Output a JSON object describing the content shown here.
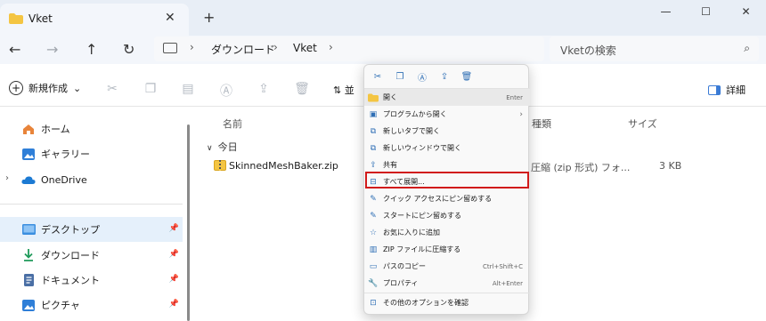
{
  "window": {
    "tab_title": "Vket",
    "tab_close": "✕",
    "new_tab": "+",
    "controls": [
      "—",
      "☐",
      "✕"
    ]
  },
  "nav": {
    "back": "←",
    "forward": "→",
    "up": "↑",
    "refresh": "↻"
  },
  "address": {
    "crumbs": [
      "ダウンロード",
      "Vket"
    ],
    "separator": "›"
  },
  "search": {
    "placeholder": "Vketの検索",
    "icon": "⌕"
  },
  "commandbar": {
    "new_label": "新規作成",
    "new_caret": "⌄",
    "sort_label": "並",
    "detail_label": "詳細"
  },
  "sidebar": {
    "items": [
      {
        "label": "ホーム",
        "icon": "home-icon"
      },
      {
        "label": "ギャラリー",
        "icon": "gallery-icon"
      },
      {
        "label": "OneDrive",
        "icon": "cloud-icon"
      },
      {
        "label": "デスクトップ",
        "icon": "desktop-icon"
      },
      {
        "label": "ダウンロード",
        "icon": "download-icon"
      },
      {
        "label": "ドキュメント",
        "icon": "document-icon"
      },
      {
        "label": "ピクチャ",
        "icon": "picture-icon"
      }
    ]
  },
  "filelist": {
    "columns": {
      "name": "名前",
      "type": "種類",
      "size": "サイズ"
    },
    "group": "今日",
    "files": [
      {
        "name": "SkinnedMeshBaker.zip",
        "type": "圧縮 (zip 形式) フォ...",
        "size": "3 KB"
      }
    ]
  },
  "context_menu": {
    "items": [
      {
        "label": "開く",
        "shortcut": "Enter"
      },
      {
        "label": "プログラムから開く",
        "shortcut": ""
      },
      {
        "label": "新しいタブで開く",
        "shortcut": ""
      },
      {
        "label": "新しいウィンドウで開く",
        "shortcut": ""
      },
      {
        "label": "共有",
        "shortcut": ""
      },
      {
        "label": "すべて展開...",
        "shortcut": ""
      },
      {
        "label": "クイック アクセスにピン留めする",
        "shortcut": ""
      },
      {
        "label": "スタートにピン留めする",
        "shortcut": ""
      },
      {
        "label": "お気に入りに追加",
        "shortcut": ""
      },
      {
        "label": "ZIP ファイルに圧縮する",
        "shortcut": ""
      },
      {
        "label": "パスのコピー",
        "shortcut": "Ctrl+Shift+C"
      },
      {
        "label": "プロパティ",
        "shortcut": "Alt+Enter"
      },
      {
        "label": "その他のオプションを確認",
        "shortcut": ""
      }
    ]
  }
}
